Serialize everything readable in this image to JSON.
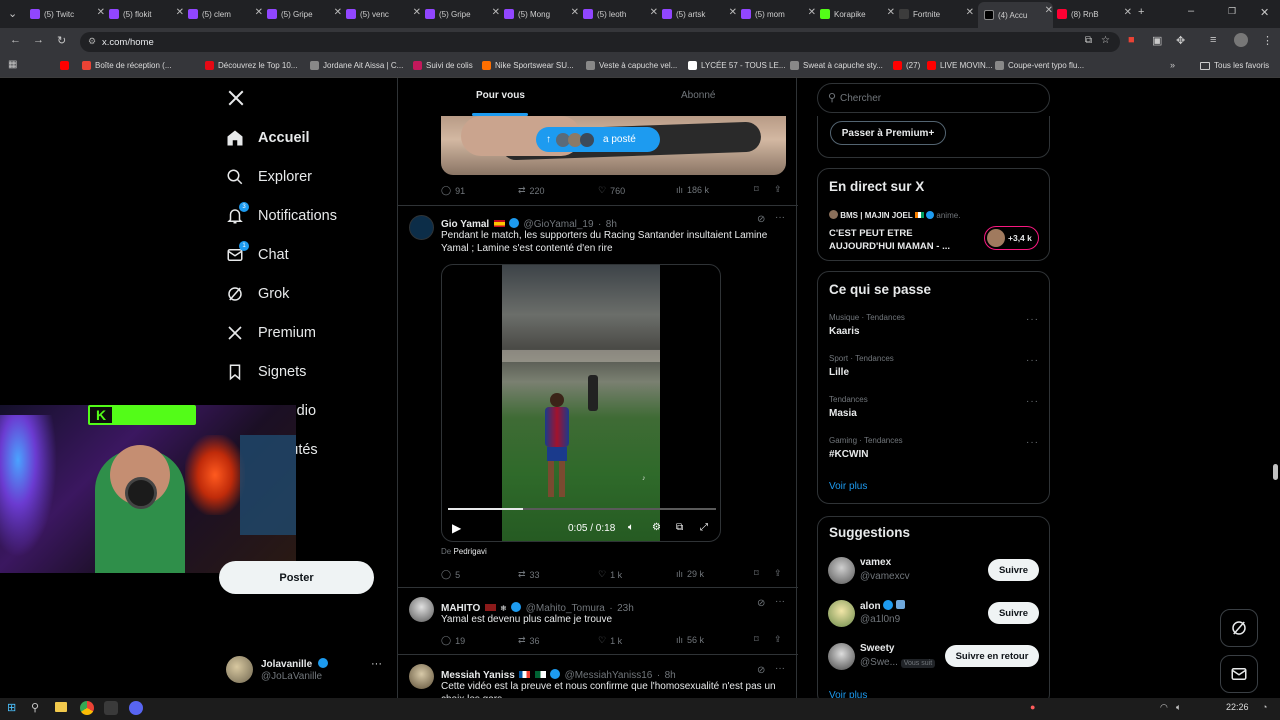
{
  "browser": {
    "tabs": [
      {
        "label": "(5) Twitc",
        "color": "#9146ff"
      },
      {
        "label": "(5) flokit",
        "color": "#9146ff"
      },
      {
        "label": "(5) clem",
        "color": "#9146ff"
      },
      {
        "label": "(5) Gripe",
        "color": "#9146ff"
      },
      {
        "label": "(5) venc",
        "color": "#9146ff"
      },
      {
        "label": "(5) Gripe",
        "color": "#9146ff"
      },
      {
        "label": "(5) Mong",
        "color": "#9146ff"
      },
      {
        "label": "(5) leoth",
        "color": "#9146ff"
      },
      {
        "label": "(5) artsk",
        "color": "#9146ff"
      },
      {
        "label": "(5) mom",
        "color": "#9146ff"
      },
      {
        "label": "Korapike",
        "color": "#53fc18"
      },
      {
        "label": "Fortnite",
        "color": "#3c3c3c"
      },
      {
        "label": "(4) Accu",
        "color": "#000000"
      },
      {
        "label": "(8) RnB",
        "color": "#ff0033"
      }
    ],
    "active_tab_index": 12,
    "url": "x.com/home",
    "bookmarks": [
      {
        "label": "",
        "color": "#ff0000"
      },
      {
        "label": "Boîte de réception (...",
        "color": "#ea4335"
      },
      {
        "label": "Découvrez le Top 10...",
        "color": "#e50914"
      },
      {
        "label": "Jordane Ait Aissa | C...",
        "color": "#888888"
      },
      {
        "label": "Suivi de colis",
        "color": "#c2185b"
      },
      {
        "label": "Nike Sportswear SU...",
        "color": "#ff6f00"
      },
      {
        "label": "Veste à capuche vel...",
        "color": "#888888"
      },
      {
        "label": "LYCÉE 57 - TOUS LE...",
        "color": "#ffffff"
      },
      {
        "label": "Sweat à capuche sty...",
        "color": "#888888"
      },
      {
        "label": "(27)",
        "color": "#ff0000"
      },
      {
        "label": "LIVE MOVIN...",
        "color": "#ff0000"
      },
      {
        "label": "Coupe-vent typo flu...",
        "color": "#888888"
      }
    ],
    "all_bookmarks": "Tous les favoris"
  },
  "sidebar": {
    "items": [
      {
        "label": "Accueil",
        "icon": "home-icon"
      },
      {
        "label": "Explorer",
        "icon": "search-icon"
      },
      {
        "label": "Notifications",
        "icon": "bell-icon",
        "badge": "3"
      },
      {
        "label": "Chat",
        "icon": "mail-icon",
        "badge": "1"
      },
      {
        "label": "Grok",
        "icon": "grok-icon"
      },
      {
        "label": "Premium",
        "icon": "x-logo-icon"
      },
      {
        "label": "Signets",
        "icon": "bookmark-icon"
      },
      {
        "label": "or Studio",
        "icon": "studio-icon"
      },
      {
        "label": "nunautés",
        "icon": "communities-icon"
      }
    ],
    "post_button": "Poster",
    "account": {
      "name": "Jolavanille",
      "handle": "@JoLaVanille"
    }
  },
  "feed": {
    "tabs": [
      "Pour vous",
      "Abonné"
    ],
    "posted_pill": "a posté",
    "first_stats": {
      "replies": "91",
      "reposts": "220",
      "likes": "760",
      "views": "186 k"
    },
    "tweets": [
      {
        "name": "Gio Yamal",
        "handle": "@GioYamal_19",
        "time": "8h",
        "text": "Pendant le match, les supporters du Racing Santander insultaient Lamine Yamal ; Lamine s'est contenté d'en rire",
        "video_time": "0:05 / 0:18",
        "video_progress": 0.28,
        "source_prefix": "De",
        "source_name": "Pedrigavi",
        "stats": {
          "replies": "5",
          "reposts": "33",
          "likes": "1 k",
          "views": "29 k"
        }
      },
      {
        "name": "MAHITO",
        "handle": "@Mahito_Tomura",
        "time": "23h",
        "text": "Yamal est devenu plus calme je trouve",
        "stats": {
          "replies": "19",
          "reposts": "36",
          "likes": "1 k",
          "views": "56 k"
        }
      },
      {
        "name": "Messiah Yaniss",
        "handle": "@MessiahYaniss16",
        "time": "8h",
        "text": "Cette vidéo est la preuve et nous confirme que l'homosexualité n'est pas un choix les gars"
      }
    ]
  },
  "right": {
    "search_placeholder": "Chercher",
    "premium_button": "Passer à Premium+",
    "live": {
      "title": "En direct sur X",
      "host": "BMS | MAJIN JOEL",
      "host_suffix": "anime.",
      "text": "C'EST PEUT ETRE AUJOURD'HUI MAMAN - ...",
      "count": "+3,4 k"
    },
    "trends": {
      "title": "Ce qui se passe",
      "items": [
        {
          "meta": "Musique · Tendances",
          "name": "Kaaris"
        },
        {
          "meta": "Sport · Tendances",
          "name": "Lille"
        },
        {
          "meta": "Tendances",
          "name": "Masia"
        },
        {
          "meta": "Gaming · Tendances",
          "name": "#KCWIN"
        }
      ],
      "more": "Voir plus"
    },
    "suggestions": {
      "title": "Suggestions",
      "items": [
        {
          "name": "vamex",
          "handle": "@vamexcv",
          "button": "Suivre",
          "follows_you": ""
        },
        {
          "name": "alon",
          "handle": "@a1l0n9",
          "button": "Suivre",
          "follows_you": ""
        },
        {
          "name": "Sweety",
          "handle": "@Swe...",
          "button": "Suivre en retour",
          "follows_you": "Vous suit"
        }
      ],
      "more": "Voir plus"
    }
  },
  "taskbar": {
    "time": "22:26"
  }
}
